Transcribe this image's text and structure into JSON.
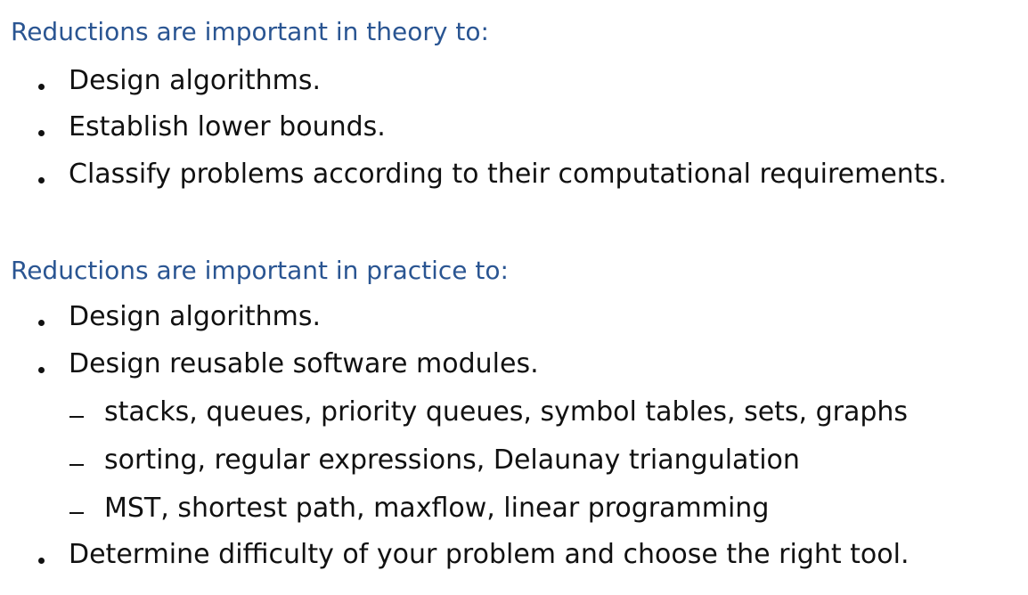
{
  "theory": {
    "heading": "Reductions are important in theory to:",
    "items": [
      "Design algorithms.",
      "Establish lower bounds.",
      "Classify problems according to their computational requirements."
    ]
  },
  "practice": {
    "heading": "Reductions are important in practice to:",
    "items": [
      "Design algorithms.",
      "Design reusable software modules.",
      "Determine difficulty of your problem and choose the right tool."
    ],
    "subitems": [
      "stacks, queues, priority queues, symbol tables, sets, graphs",
      "sorting, regular expressions, Delaunay triangulation",
      "MST, shortest path, maxflow, linear programming"
    ]
  }
}
